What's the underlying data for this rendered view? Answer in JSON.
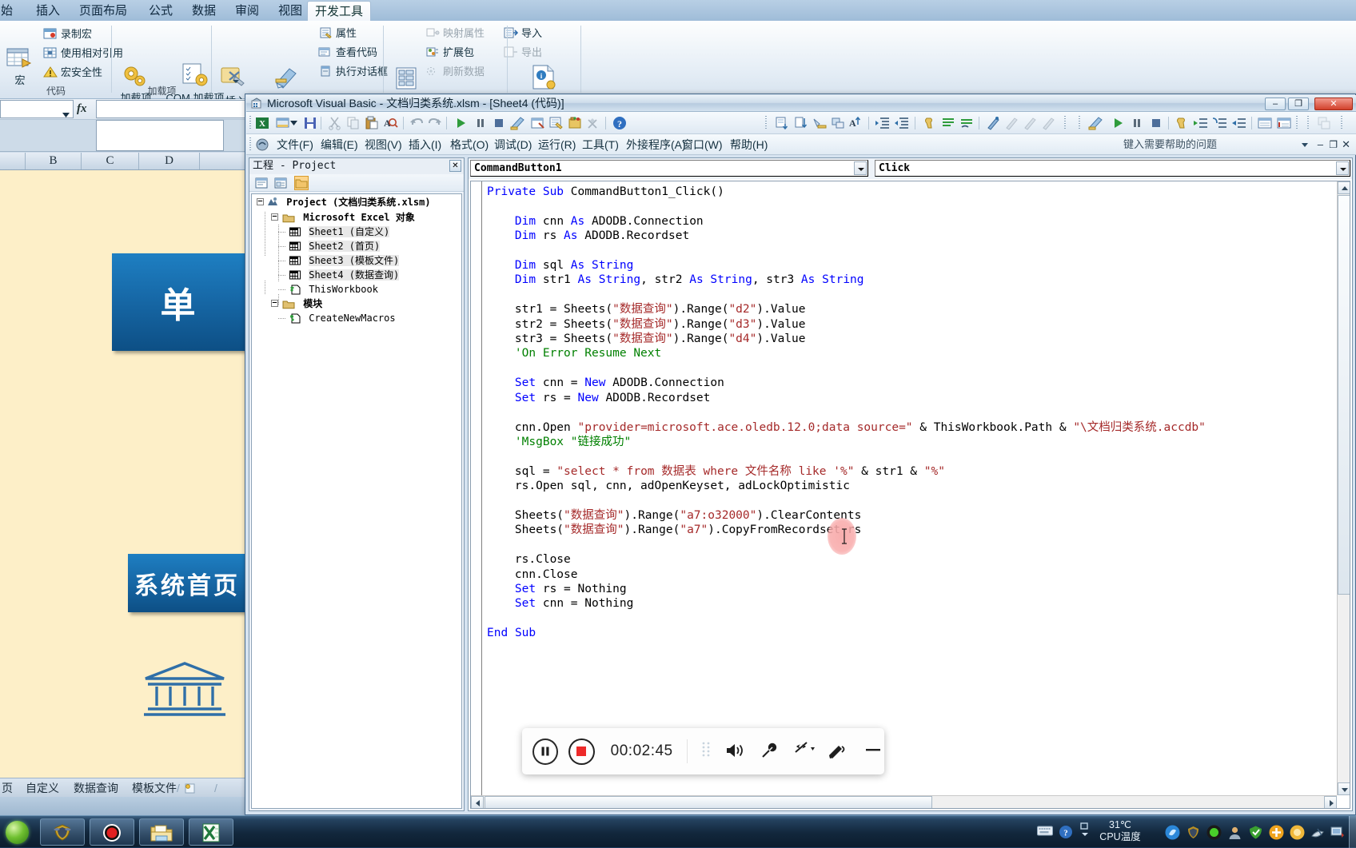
{
  "excel": {
    "ribbon_tabs": [
      {
        "label": "始",
        "active": false
      },
      {
        "label": "插入",
        "active": false
      },
      {
        "label": "页面布局",
        "active": false
      },
      {
        "label": "公式",
        "active": false
      },
      {
        "label": "数据",
        "active": false
      },
      {
        "label": "审阅",
        "active": false
      },
      {
        "label": "视图",
        "active": false
      },
      {
        "label": "开发工具",
        "active": true
      }
    ],
    "groups": [
      {
        "label": "代码"
      },
      {
        "label": "加载项"
      },
      {
        "label": ""
      },
      {
        "label": ""
      }
    ],
    "commands": {
      "macro": "宏",
      "record_macro": "录制宏",
      "use_relative_refs": "使用相对引用",
      "macro_security": "宏安全性",
      "addins": "加载项",
      "com_addins": "COM 加载项",
      "insert": "插入",
      "design_mode": "设计模式",
      "properties": "属性",
      "view_code": "查看代码",
      "run_dialog": "执行对话框",
      "source": "源",
      "map_properties": "映射属性",
      "expansion_packs": "扩展包",
      "refresh_data": "刷新数据",
      "import": "导入",
      "export": "导出",
      "document_panel": "文档面板"
    },
    "namebox_value": "",
    "fx_label": "fx",
    "column_headers": [
      "B",
      "C",
      "D"
    ],
    "sheet_buttons": [
      {
        "label": "单",
        "size": "big"
      },
      {
        "label": "系统首页",
        "size": "small"
      }
    ],
    "sheet_tabs": [
      "页",
      "自定义",
      "数据查询",
      "模板文件"
    ]
  },
  "vba": {
    "title": "Microsoft Visual Basic - 文档归类系统.xlsm - [Sheet4 (代码)]",
    "window_buttons": {
      "minimize": "–",
      "restore": "❐",
      "close": "✕"
    },
    "menus": [
      "文件(F)",
      "编辑(E)",
      "视图(V)",
      "插入(I)",
      "格式(O)",
      "调试(D)",
      "运行(R)",
      "工具(T)",
      "外接程序(A)",
      "窗口(W)",
      "帮助(H)"
    ],
    "help_placeholder": "键入需要帮助的问题",
    "project_panel": {
      "caption": "工程 - Project",
      "close_label": "✕",
      "toolbar_buttons": [
        "view-code-icon",
        "view-object-icon",
        "toggle-folders-icon"
      ],
      "tree": [
        {
          "label": "Project (文档归类系统.xlsm)",
          "depth": 0,
          "expanded": true,
          "icon": "project-icon",
          "bold": true
        },
        {
          "label": "Microsoft Excel 对象",
          "depth": 1,
          "expanded": true,
          "icon": "folder-icon",
          "bold": false
        },
        {
          "label": "Sheet1 (自定义)",
          "depth": 2,
          "expanded": null,
          "icon": "sheet-icon",
          "bold": false
        },
        {
          "label": "Sheet2 (首页)",
          "depth": 2,
          "expanded": null,
          "icon": "sheet-icon",
          "bold": false
        },
        {
          "label": "Sheet3 (模板文件)",
          "depth": 2,
          "expanded": null,
          "icon": "sheet-icon",
          "bold": false
        },
        {
          "label": "Sheet4 (数据查询)",
          "depth": 2,
          "expanded": null,
          "icon": "sheet-icon",
          "bold": false
        },
        {
          "label": "ThisWorkbook",
          "depth": 2,
          "expanded": null,
          "icon": "workbook-icon",
          "bold": false
        },
        {
          "label": "模块",
          "depth": 1,
          "expanded": true,
          "icon": "folder-icon",
          "bold": false
        },
        {
          "label": "CreateNewMacros",
          "depth": 2,
          "expanded": null,
          "icon": "module-icon",
          "bold": false
        }
      ]
    },
    "code_window": {
      "object_combo": "CommandButton1",
      "procedure_combo": "Click",
      "code": "Private Sub CommandButton1_Click()\n\n    Dim cnn As ADODB.Connection\n    Dim rs As ADODB.Recordset\n\n    Dim sql As String\n    Dim str1 As String, str2 As String, str3 As String\n\n    str1 = Sheets(\"数据查询\").Range(\"d2\").Value\n    str2 = Sheets(\"数据查询\").Range(\"d3\").Value\n    str3 = Sheets(\"数据查询\").Range(\"d4\").Value\n    'On Error Resume Next\n\n    Set cnn = New ADODB.Connection\n    Set rs = New ADODB.Recordset\n\n    cnn.Open \"provider=microsoft.ace.oledb.12.0;data source=\" & ThisWorkbook.Path & \"\\文档归类系统.accdb\"\n    'MsgBox \"链接成功\"\n\n    sql = \"select * from 数据表 where 文件名称 like '%\" & str1 & \"%\"\n    rs.Open sql, cnn, adOpenKeyset, adLockOptimistic\n\n    Sheets(\"数据查询\").Range(\"a7:o32000\").ClearContents\n    Sheets(\"数据查询\").Range(\"a7\").CopyFromRecordset rs\n\n    rs.Close\n    cnn.Close\n    Set rs = Nothing\n    Set cnn = Nothing\n\nEnd Sub"
    }
  },
  "recorder": {
    "pause_label": "pause-icon",
    "stop_label": "stop-icon",
    "elapsed": "00:02:45",
    "icons": [
      "drag-handle-icon",
      "speaker-icon",
      "microphone-icon",
      "camera-off-icon",
      "pen-icon",
      "minimize-icon"
    ]
  },
  "taskbar": {
    "start_label": "start-orb",
    "items": [
      "shield-app-icon",
      "recorder-app-icon",
      "folder-app-icon",
      "excel-app-icon"
    ],
    "cpu_temp_value": "31℃",
    "cpu_temp_label": "CPU温度"
  },
  "colors": {
    "accent_blue": "#1769a8",
    "sheet_bg": "#fdefc8",
    "code_string": "#a52a2a",
    "code_comment": "#008000",
    "code_keyword": "#0000ff",
    "record_red": "#ee2b2b"
  }
}
